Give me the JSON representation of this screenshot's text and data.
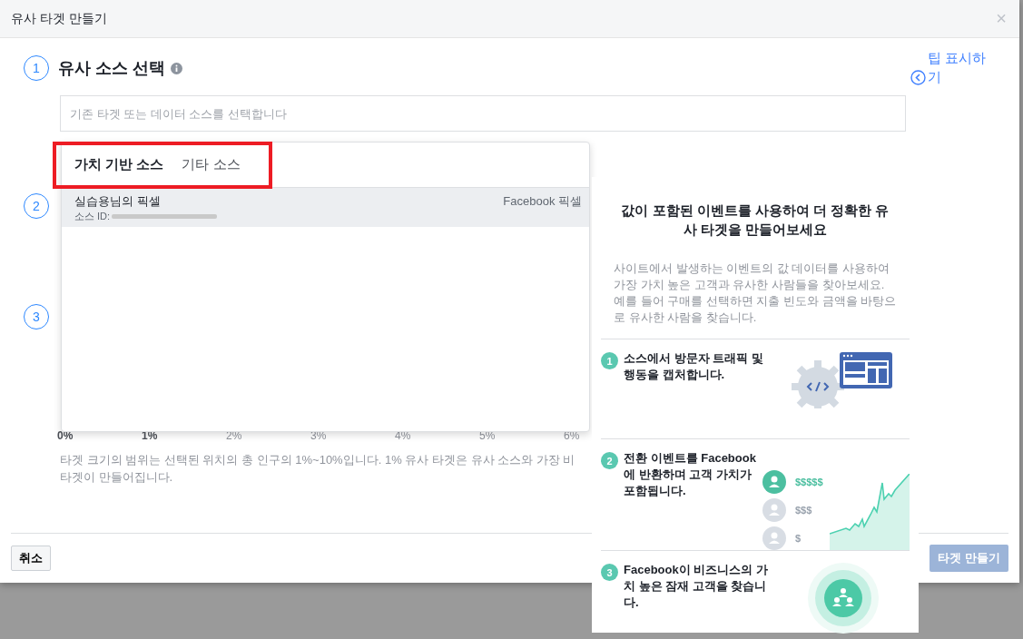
{
  "dialog": {
    "title": "유사 타겟 만들기",
    "close": "×"
  },
  "tip_toggle": {
    "label": "팁 표시하기"
  },
  "steps": [
    {
      "number": "1",
      "title": "유사 소스 선택"
    },
    {
      "number": "2"
    },
    {
      "number": "3"
    }
  ],
  "source_field": {
    "placeholder": "기존 타겟 또는 데이터 소스를 선택합니다"
  },
  "source_dropdown": {
    "tabs": [
      {
        "label": "가치 기반 소스",
        "selected": true
      },
      {
        "label": "기타 소스",
        "selected": false
      }
    ],
    "items": [
      {
        "name": "실습용님의 픽셀",
        "id_label": "소스 ID:",
        "type": "Facebook 픽셀",
        "selected": true
      }
    ]
  },
  "size_scale": [
    {
      "label": "0%",
      "in_range": true
    },
    {
      "label": "1%",
      "in_range": true
    },
    {
      "label": "2%",
      "in_range": false
    },
    {
      "label": "3%",
      "in_range": false
    },
    {
      "label": "4%",
      "in_range": false
    },
    {
      "label": "5%",
      "in_range": false
    },
    {
      "label": "6%",
      "in_range": false
    }
  ],
  "size_note": "타겟 크기의 범위는 선택된 위치의 총 인구의 1%~10%입니다. 1% 유사 타겟은 유사 소스와 가장 비",
  "size_note_2": "타겟이 만들어집니다.",
  "tip_panel": {
    "title": "값이 포함된 이벤트를 사용하여 더 정확한 유사 타겟을 만들어보세요",
    "description": "사이트에서 발생하는 이벤트의 값 데이터를 사용하여 가장 가치 높은 고객과 유사한 사람들을 찾아보세요. 예를 들어 구매를 선택하면 지출 빈도와 금액을 바탕으로 유사한 사람을 찾습니다.",
    "steps": [
      {
        "number": "1",
        "text": "소스에서 방문자 트래픽 및 행동을 캡처합니다.",
        "kind": "capture"
      },
      {
        "number": "2",
        "text": "전환 이벤트를 **Facebook**에 반환하며 고객 가치가 포함됩니다.",
        "kind": "value",
        "tiers": [
          {
            "label": "$$$$$",
            "active": true
          },
          {
            "label": "$$$",
            "active": false
          },
          {
            "label": "$",
            "active": false
          }
        ]
      },
      {
        "number": "3",
        "text": "**Facebook**이 비즈니스의 가치 높은 잠재 고객을 찾습니다.",
        "kind": "audience"
      }
    ]
  },
  "buttons": {
    "cancel": "취소",
    "create": {
      "label": "타겟 만들기",
      "disabled": true
    }
  }
}
